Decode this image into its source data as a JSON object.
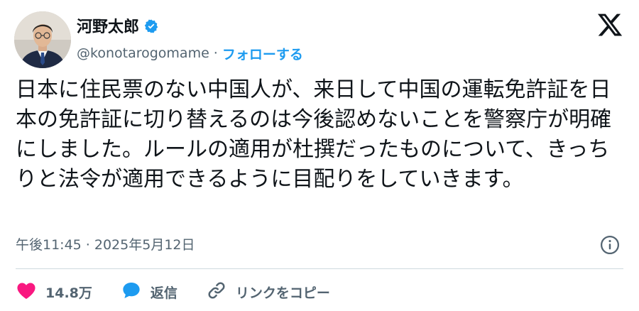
{
  "author": {
    "display_name": "河野太郎",
    "handle": "@konotarogomame",
    "separator": "·",
    "follow_label": "フォローする"
  },
  "tweet": {
    "text": "日本に住民票のない中国人が、来日して中国の運転免許証を日本の免許証に切り替えるのは今後認めないことを警察庁が明確にしました。ルールの適用が杜撰だったものについて、きっちりと法令が適用できるように目配りをしていきます。",
    "timestamp": "午後11:45 · 2025年5月12日"
  },
  "actions": {
    "like_count": "14.8万",
    "reply_label": "返信",
    "copy_link_label": "リンクをコピー"
  },
  "icons": {
    "verified": "verified-badge-icon",
    "x_logo": "x-logo-icon",
    "info": "info-icon",
    "heart": "heart-icon",
    "reply": "reply-bubble-icon",
    "link": "link-icon"
  },
  "colors": {
    "accent": "#1d9bf0",
    "like": "#f91880",
    "text": "#0f1419",
    "muted": "#536471",
    "divider": "#cfd9de"
  }
}
